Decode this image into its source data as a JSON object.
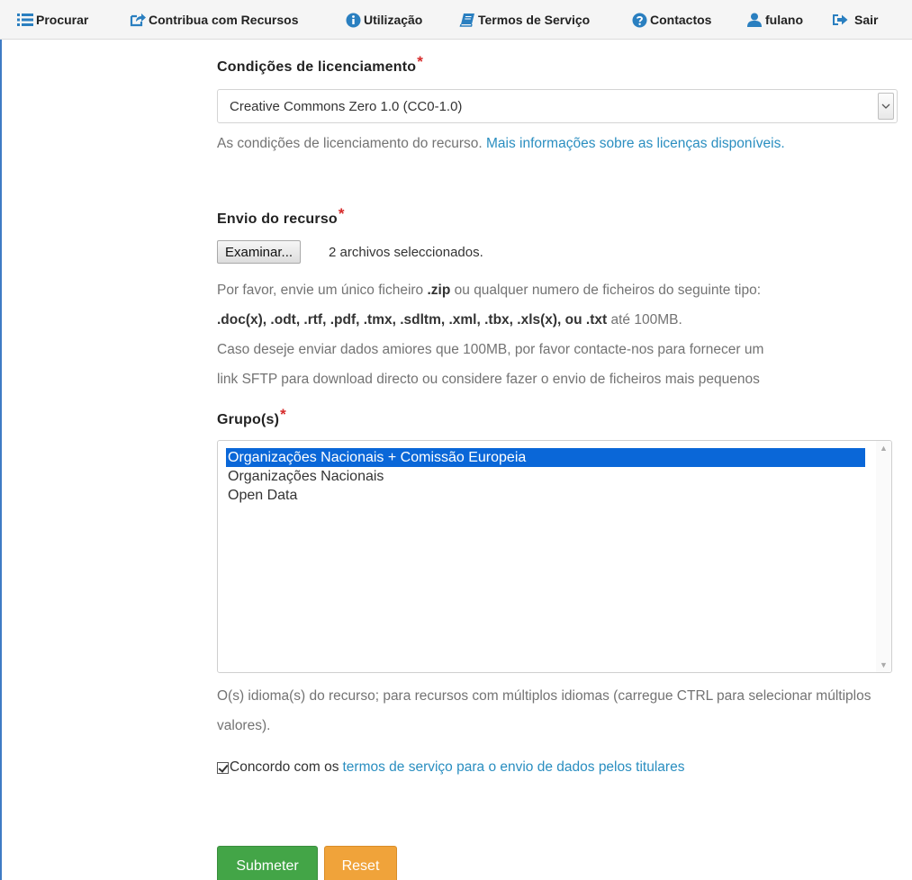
{
  "nav": {
    "search": "Procurar",
    "contribute": "Contribua com Recursos",
    "usage": "Utilização",
    "terms": "Termos de Serviço",
    "contacts": "Contactos",
    "user": "fulano",
    "logout": "Sair"
  },
  "license": {
    "label": "Condições de licenciamento",
    "required_mark": "*",
    "selected": "Creative Commons Zero 1.0 (CC0-1.0)",
    "help_text": "As condições de licenciamento do recurso.",
    "help_link": "Mais informações sobre as licenças disponíveis."
  },
  "upload": {
    "label": "Envio do recurso",
    "required_mark": "*",
    "browse_button": "Examinar...",
    "file_status": "2 archivos seleccionados.",
    "help_line1_a": "Por favor, envie um único ficheiro",
    "help_zip": ".zip",
    "help_line1_b": "ou qualquer numero de ficheiros do seguinte tipo:",
    "help_types": ".doc(x), .odt, .rtf, .pdf, .tmx, .sdltm, .xml, .tbx, .xls(x), ou .txt",
    "help_limit": "até 100MB.",
    "help_line3": "Caso deseje enviar dados amiores que 100MB, por favor contacte-nos para fornecer um",
    "help_line4": "link SFTP para download directo ou considere fazer o envio de ficheiros mais pequenos"
  },
  "groups": {
    "label": "Grupo(s)",
    "required_mark": "*",
    "options": [
      "Organizações Nacionais + Comissão Europeia",
      "Organizações Nacionais",
      "Open Data"
    ],
    "selected_index": 0,
    "help_text": "O(s) idioma(s) do recurso; para recursos com múltiplos idiomas (carregue CTRL para selecionar múltiplos valores)."
  },
  "agreement": {
    "checked": true,
    "text": "Concordo com os",
    "link": "termos de serviço para o envio de dados pelos titulares"
  },
  "buttons": {
    "submit": "Submeter",
    "reset": "Reset"
  },
  "colors": {
    "link": "#2a8ec0",
    "required": "#d62a2a",
    "submit": "#43a547",
    "reset": "#f0a33a",
    "selection": "#0a67d8",
    "nav_icon": "#2a7fc0"
  }
}
